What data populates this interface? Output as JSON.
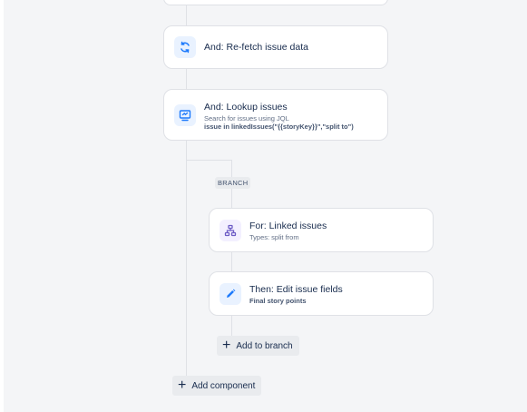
{
  "flow": {
    "refetch": {
      "title": "And: Re-fetch issue data",
      "icon": "refresh-icon"
    },
    "lookup": {
      "title": "And: Lookup issues",
      "subtitle": "Search for issues using JQL",
      "jql": "issue in linkedIssues(\"{{storyKey}}\",\"split to\")",
      "icon": "monitor-search-icon"
    },
    "branch_label": "BRANCH",
    "linked": {
      "title": "For: Linked issues",
      "subtitle": "Types: split from",
      "icon": "hierarchy-icon"
    },
    "edit": {
      "title": "Then: Edit issue fields",
      "subtitle": "Final story points",
      "icon": "pencil-icon"
    },
    "add_to_branch": "Add to branch",
    "add_component": "Add component"
  },
  "colors": {
    "accent": "#1d7afc",
    "purple": "#8270db",
    "line": "#dfe1e6"
  }
}
